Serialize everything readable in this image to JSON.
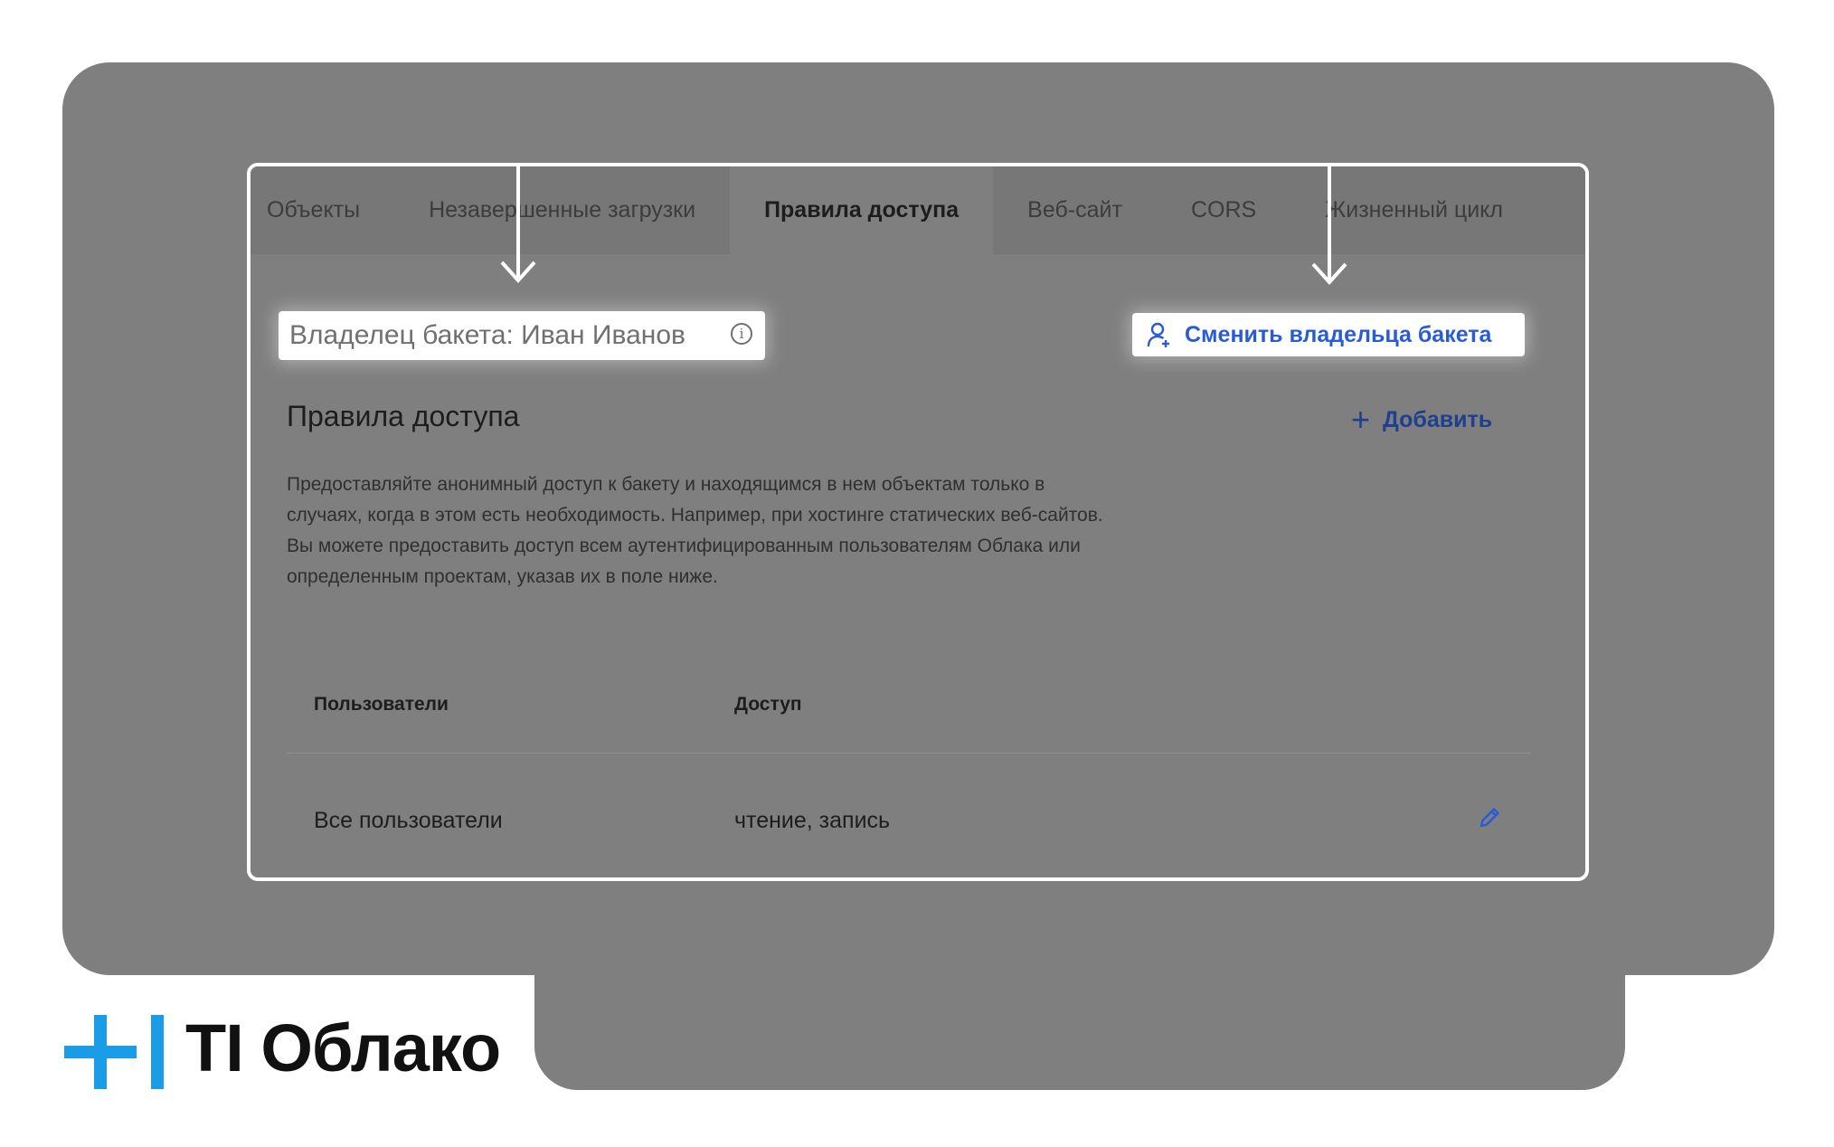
{
  "tabs": {
    "items": [
      {
        "label": "Объекты"
      },
      {
        "label": "Незавершенные загрузки"
      },
      {
        "label": "Правила доступа"
      },
      {
        "label": "Веб-сайт"
      },
      {
        "label": "CORS"
      },
      {
        "label": "Жизненный цикл"
      }
    ],
    "active_index": 2
  },
  "owner": {
    "label": "Владелец бакета: Иван Иванов",
    "info_icon": "info-icon"
  },
  "change_owner": {
    "label": "Сменить владельца бакета",
    "icon": "user-plus-icon"
  },
  "access_rules": {
    "title": "Правила доступа",
    "add_label": "Добавить",
    "description_lines": [
      "Предоставляйте анонимный доступ к бакету и находящимся в нем объектам только в",
      "случаях, когда в этом есть необходимость. Например, при хостинге статических веб-сайтов.",
      "Вы можете предоставить доступ всем аутентифицированным пользователям Облака или",
      "определенным проектам, указав их в поле ниже."
    ]
  },
  "table": {
    "columns": [
      "Пользователи",
      "Доступ"
    ],
    "rows": [
      {
        "users": "Все пользователи",
        "access": "чтение, запись",
        "action_icon": "pencil-icon"
      }
    ]
  },
  "brand": {
    "name": "TI Облако",
    "accent_color": "#1a9ce6"
  },
  "colors": {
    "link_blue": "#2a5bd7",
    "backdrop_gray": "#7f7f7f"
  }
}
